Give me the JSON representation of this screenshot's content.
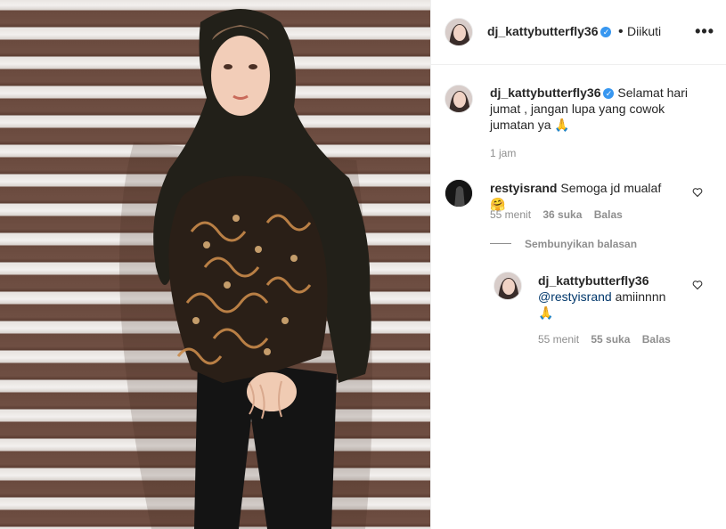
{
  "post_author": {
    "username": "dj_kattybutterfly36",
    "follow_status": "Diikuti",
    "separator": "•",
    "more_icon": "more-horizontal-icon"
  },
  "caption": {
    "username": "dj_kattybutterfly36",
    "text": "Selamat hari jumat , jangan lupa yang cowok jumatan ya 🙏",
    "time": "1 jam"
  },
  "comments": [
    {
      "username": "restyisrand",
      "text": "Semoga jd mualaf 🤗",
      "time": "55 menit",
      "likes": "36 suka",
      "reply_label": "Balas",
      "toggle_replies": "Sembunyikan balasan",
      "replies": [
        {
          "username": "dj_kattybutterfly36",
          "mention": "@restyisrand",
          "text": " amiinnnn",
          "emoji": "🙏",
          "time": "55 menit",
          "likes": "55 suka",
          "reply_label": "Balas"
        }
      ]
    }
  ],
  "colors": {
    "verified": "#3897f0",
    "muted": "#8e8e8e",
    "link": "#00376b",
    "border": "#efefef"
  }
}
